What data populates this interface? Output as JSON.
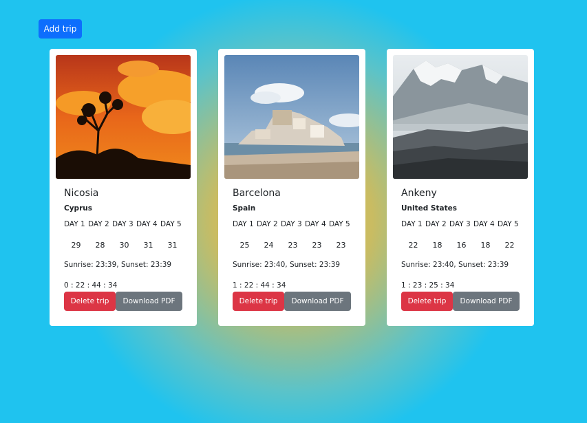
{
  "toolbar": {
    "add_trip_label": "Add trip"
  },
  "trips": [
    {
      "city": "Nicosia",
      "country": "Cyprus",
      "image": "sunset-silhouette-tree",
      "days": [
        "DAY 1",
        "DAY 2",
        "DAY 3",
        "DAY 4",
        "DAY 5"
      ],
      "temps": [
        "29",
        "28",
        "30",
        "31",
        "31"
      ],
      "sun": "Sunrise: 23:39, Sunset: 23:39",
      "countdown": "0 : 22 : 44 : 34",
      "delete_label": "Delete trip",
      "pdf_label": "Download PDF"
    },
    {
      "city": "Barcelona",
      "country": "Spain",
      "image": "coastal-castle-town",
      "days": [
        "DAY 1",
        "DAY 2",
        "DAY 3",
        "DAY 4",
        "DAY 5"
      ],
      "temps": [
        "25",
        "24",
        "23",
        "23",
        "23"
      ],
      "sun": "Sunrise: 23:40, Sunset: 23:39",
      "countdown": "1 : 22 : 44 : 34",
      "delete_label": "Delete trip",
      "pdf_label": "Download PDF"
    },
    {
      "city": "Ankeny",
      "country": "United States",
      "image": "misty-mountains",
      "days": [
        "DAY 1",
        "DAY 2",
        "DAY 3",
        "DAY 4",
        "DAY 5"
      ],
      "temps": [
        "22",
        "18",
        "16",
        "18",
        "22"
      ],
      "sun": "Sunrise: 23:40, Sunset: 23:39",
      "countdown": "1 : 23 : 25 : 34",
      "delete_label": "Delete trip",
      "pdf_label": "Download PDF"
    }
  ],
  "colors": {
    "primary": "#0d6efd",
    "danger": "#dc3545",
    "secondary": "#6c757d",
    "background": "#1fc3ef"
  }
}
